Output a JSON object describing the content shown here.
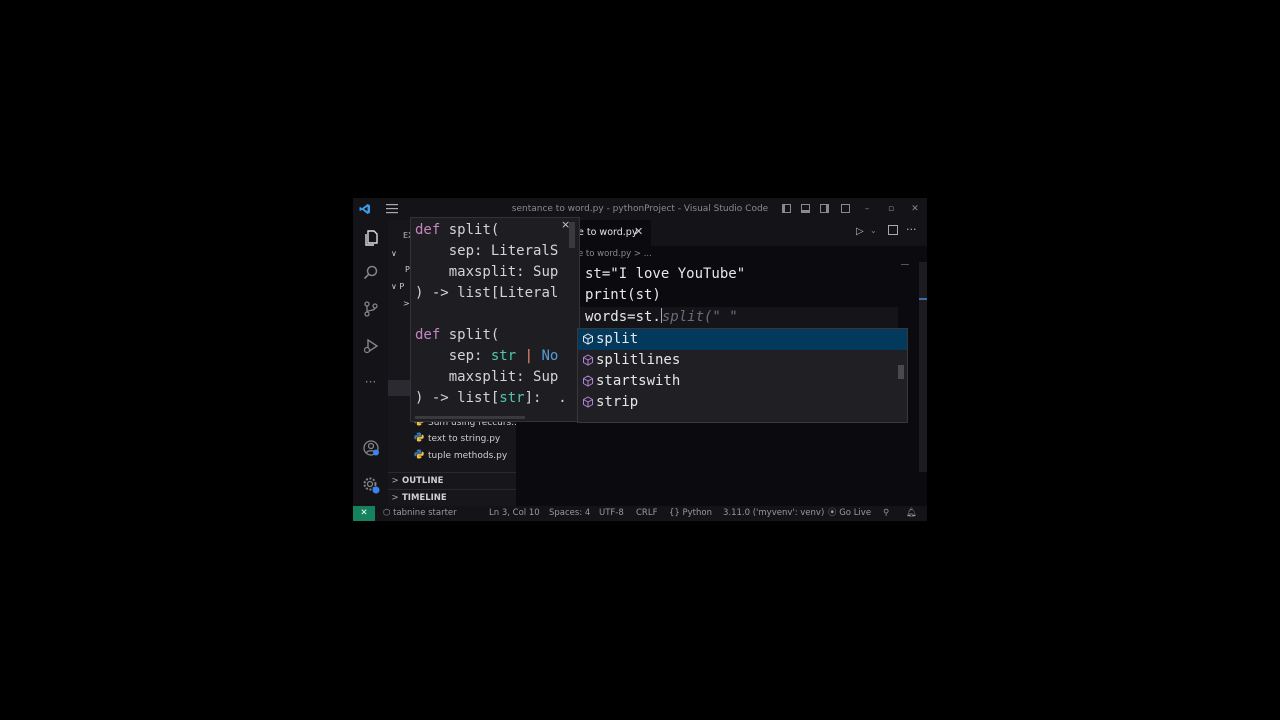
{
  "window": {
    "title": "sentance to word.py - pythonProject - Visual Studio Code",
    "menu_icon": "hamburger-menu-icon",
    "controls": [
      "–",
      "▫",
      "✕"
    ]
  },
  "activity_bar": {
    "icons": [
      "files-icon",
      "search-icon",
      "source-control-icon",
      "run-debug-icon",
      "more-icon",
      "account-icon",
      "settings-icon"
    ],
    "more_glyph": "···"
  },
  "sidebar": {
    "explorer_label": "EX",
    "partial_rows": [
      "∨",
      "P",
      "∨ P",
      ">"
    ],
    "files": [
      "Sum using reccurs...",
      "text to string.py",
      "tuple methods.py"
    ],
    "sections": [
      {
        "chevron": ">",
        "label": "OUTLINE"
      },
      {
        "chevron": ">",
        "label": "TIMELINE"
      }
    ]
  },
  "editor": {
    "tab": {
      "label": "e to word.py",
      "close": "✕"
    },
    "breadcrumb": "e to word.py > ...",
    "lines": [
      "st=\"I love YouTube\"",
      "print(st)",
      "words=st."
    ],
    "ghost_text": "split(\" \""
  },
  "hover": {
    "close": "×",
    "lines": [
      [
        "def",
        " split("
      ],
      [
        "    sep: ",
        "LiteralS"
      ],
      [
        "    maxsplit: ",
        "Sup"
      ],
      [
        ") -> list[",
        "Literal"
      ],
      [
        "",
        ""
      ],
      [
        "def",
        " split("
      ],
      [
        "    sep: ",
        "str",
        " | ",
        "No"
      ],
      [
        "    maxsplit: ",
        "Sup"
      ],
      [
        ") -> list[",
        "str",
        "]:  ."
      ]
    ]
  },
  "suggest": {
    "items": [
      "split",
      "splitlines",
      "startswith",
      "strip"
    ],
    "selected_index": 0,
    "item_icon": "method-cube-icon"
  },
  "statusbar": {
    "remote": "✕",
    "tabnine": "tabnine starter",
    "position": "Ln 3, Col 10",
    "spaces": "Spaces: 4",
    "encoding": "UTF-8",
    "eol": "CRLF",
    "language": "Python",
    "interpreter": "3.11.0 ('myvenv': venv)",
    "golive": "Go Live",
    "accent": "#16825d"
  }
}
